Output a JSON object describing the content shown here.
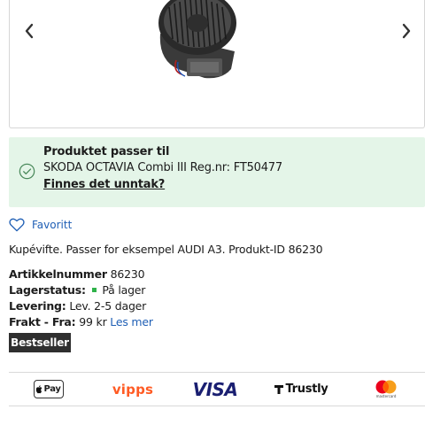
{
  "gallery": {
    "prev_icon": "chevron-left-icon",
    "next_icon": "chevron-right-icon",
    "image": "cabin-blower-fan-motor"
  },
  "fitment": {
    "icon": "check-circle-icon",
    "title": "Produktet passer til",
    "vehicle": "SKODA OCTAVIA Combi III Reg.nr: FT50477",
    "exception_link": "Finnes det unntak?"
  },
  "favorite": {
    "icon": "heart-outline-icon",
    "label": "Favoritt"
  },
  "description": "Kupévifte. Passer for eksempel AUDI A3. Produkt-ID 86230",
  "details": {
    "article_label": "Artikkelnummer",
    "article_value": "86230",
    "stock_label": "Lagerstatus:",
    "stock_value": "På lager",
    "delivery_label": "Levering:",
    "delivery_value": "Lev. 2-5 dager",
    "freight_label": "Frakt - Fra:",
    "freight_value": "99 kr",
    "read_more": "Les mer"
  },
  "badge": "Bestseller",
  "payments": {
    "apple_pay": "Pay",
    "vipps": "vipps",
    "visa": "VISA",
    "trustly": "Trustly",
    "mastercard_caption": "mastercard"
  },
  "colors": {
    "fit_background": "#e4f5e8",
    "link": "#1f5fb5",
    "stock_green": "#2fb24a",
    "badge_bg": "#2f2f2f",
    "vipps_orange": "#ff5b24",
    "visa_blue": "#1a1f71"
  }
}
